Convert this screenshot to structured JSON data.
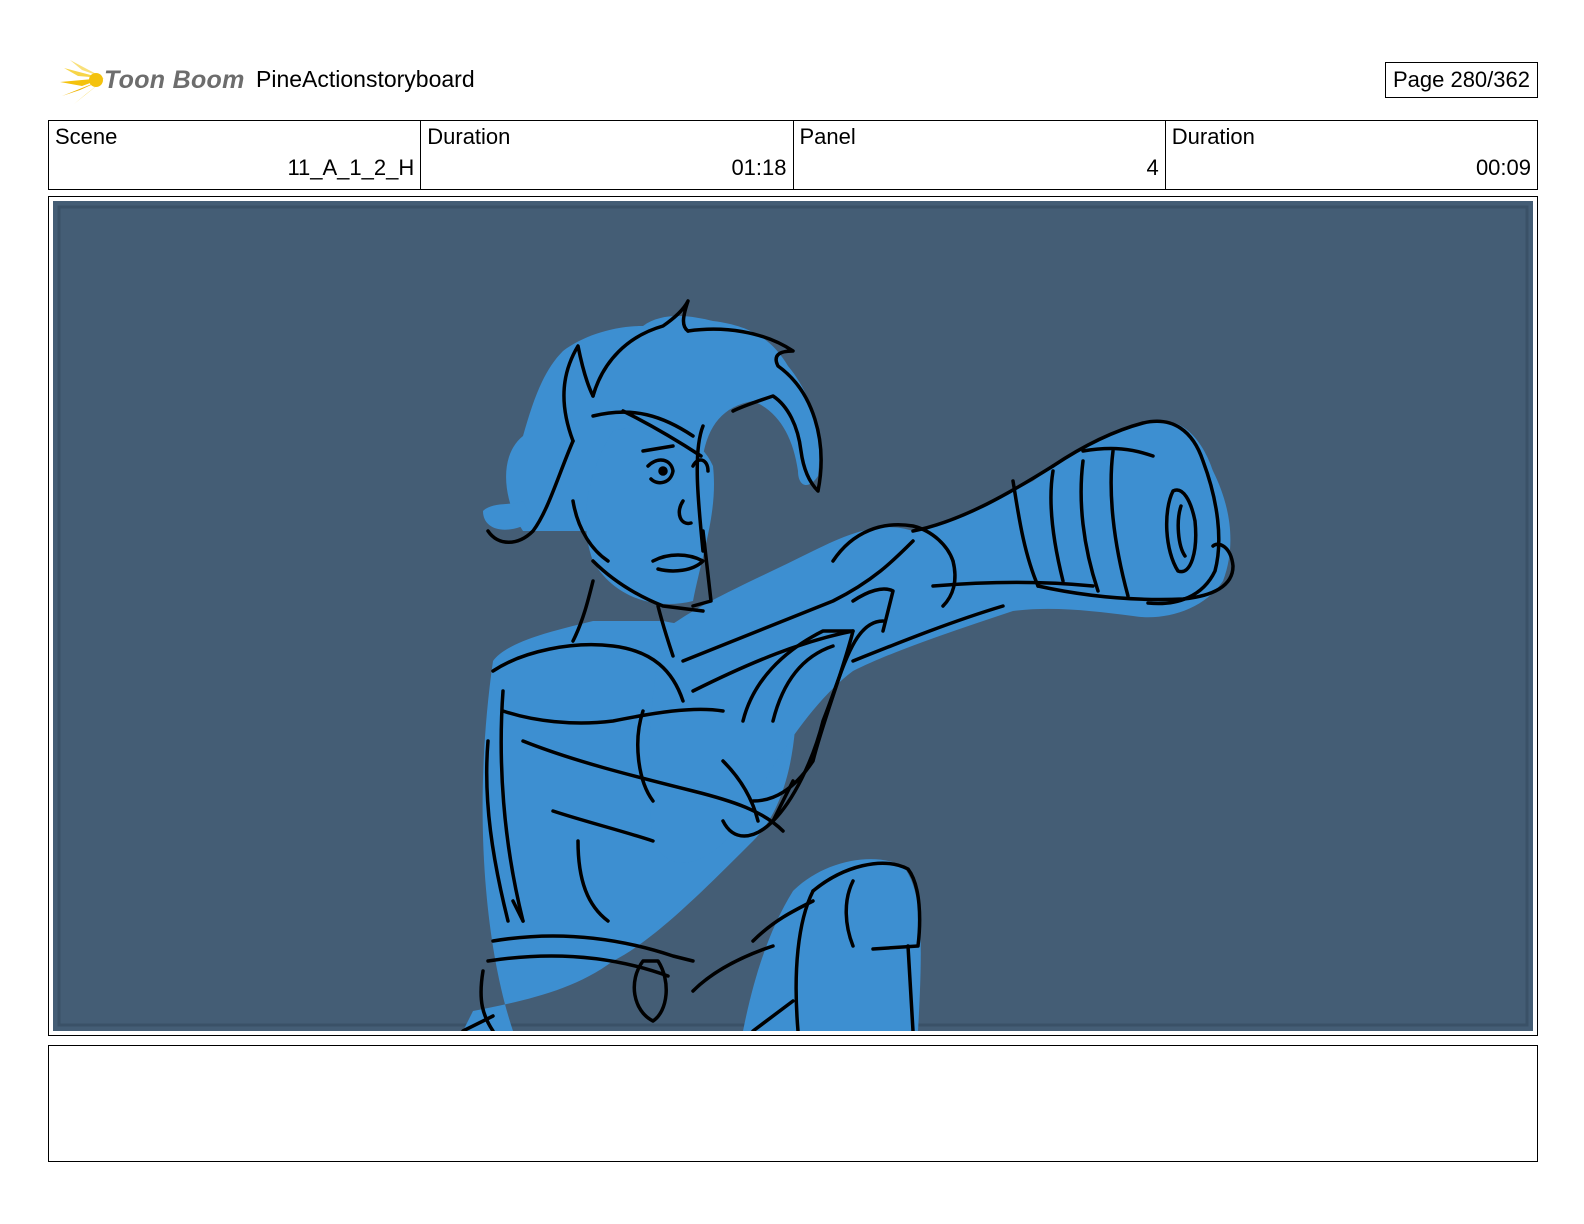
{
  "header": {
    "logo_text": "Toon Boom",
    "project_title": "PineActionstoryboard",
    "page_indicator": "Page 280/362"
  },
  "info_table": [
    {
      "label": "Scene",
      "value": "11_A_1_2_H"
    },
    {
      "label": "Duration",
      "value": "01:18"
    },
    {
      "label": "Panel",
      "value": "4"
    },
    {
      "label": "Duration",
      "value": "00:09"
    }
  ],
  "colors": {
    "panel_background": "#445d75",
    "character_fill": "#3d8fd1",
    "line": "#000000",
    "logo_accent": "#f4c20d"
  },
  "notes": ""
}
